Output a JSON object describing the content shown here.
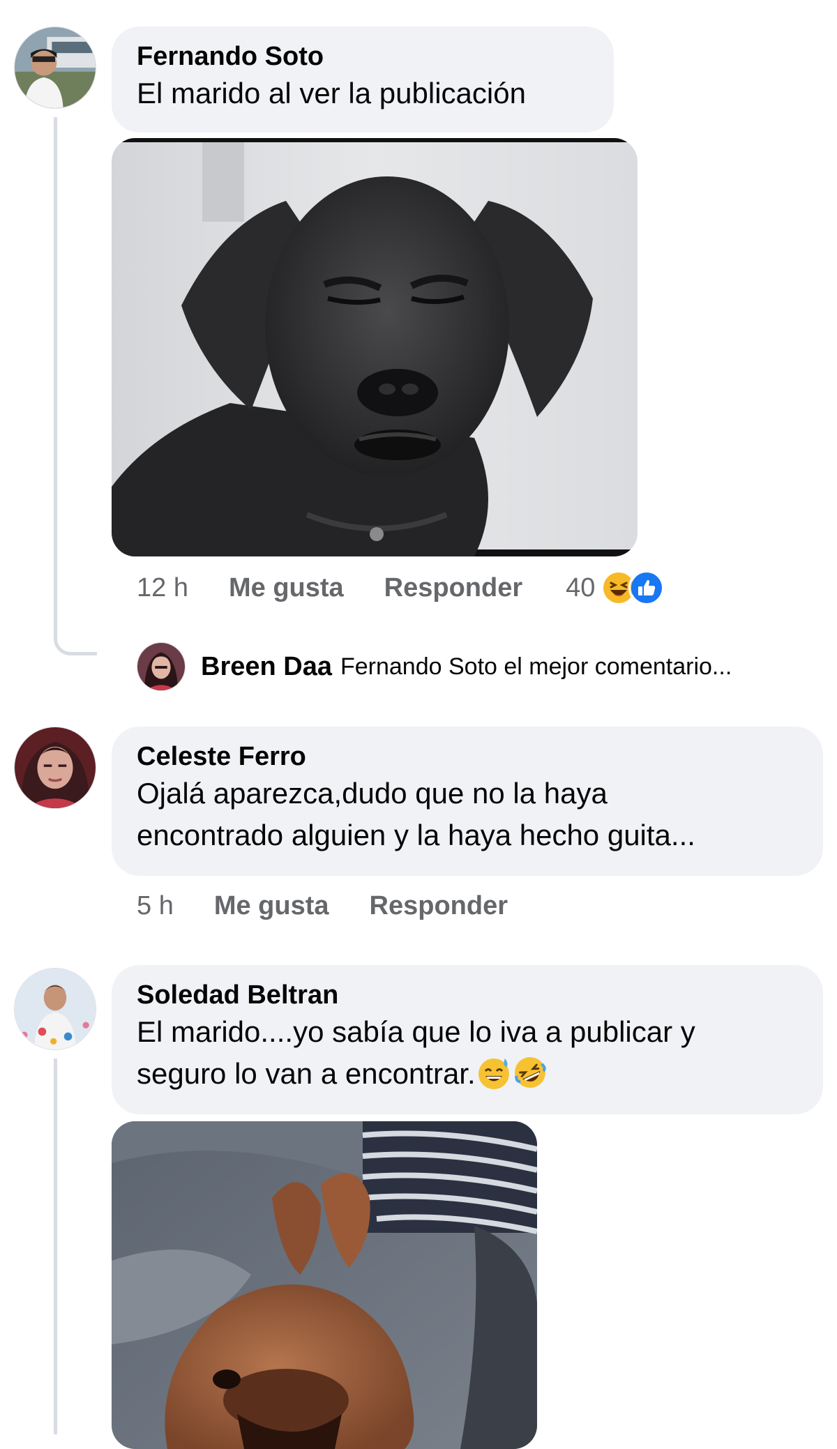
{
  "comments": [
    {
      "author": "Fernando Soto",
      "text": "El marido al ver la publicación",
      "media": "black-dog-meme",
      "time": "12 h",
      "like_label": "Me gusta",
      "reply_label": "Responder",
      "reaction_count": "40",
      "reactions": [
        "haha",
        "like"
      ],
      "reply_preview": {
        "author": "Breen Daa",
        "text": "Fernando Soto el mejor  comentario..."
      }
    },
    {
      "author": "Celeste Ferro",
      "text_lines": [
        "Ojalá aparezca,dudo que no la haya",
        "encontrado alguien y la haya hecho guita..."
      ],
      "time": "5 h",
      "like_label": "Me gusta",
      "reply_label": "Responder"
    },
    {
      "author": "Soledad Beltran",
      "text_lines": [
        "El marido....yo sabía que lo iva a publicar y",
        "seguro lo van a encontrar."
      ],
      "trailing_emojis": [
        "sweat-smile",
        "rolling-laugh"
      ],
      "media": "brown-dog-gif"
    }
  ],
  "colors": {
    "bubble": "#f0f2f5",
    "secondary_text": "#65676b",
    "like_blue": "#1877f2",
    "haha_yellow": "#f7b928"
  }
}
